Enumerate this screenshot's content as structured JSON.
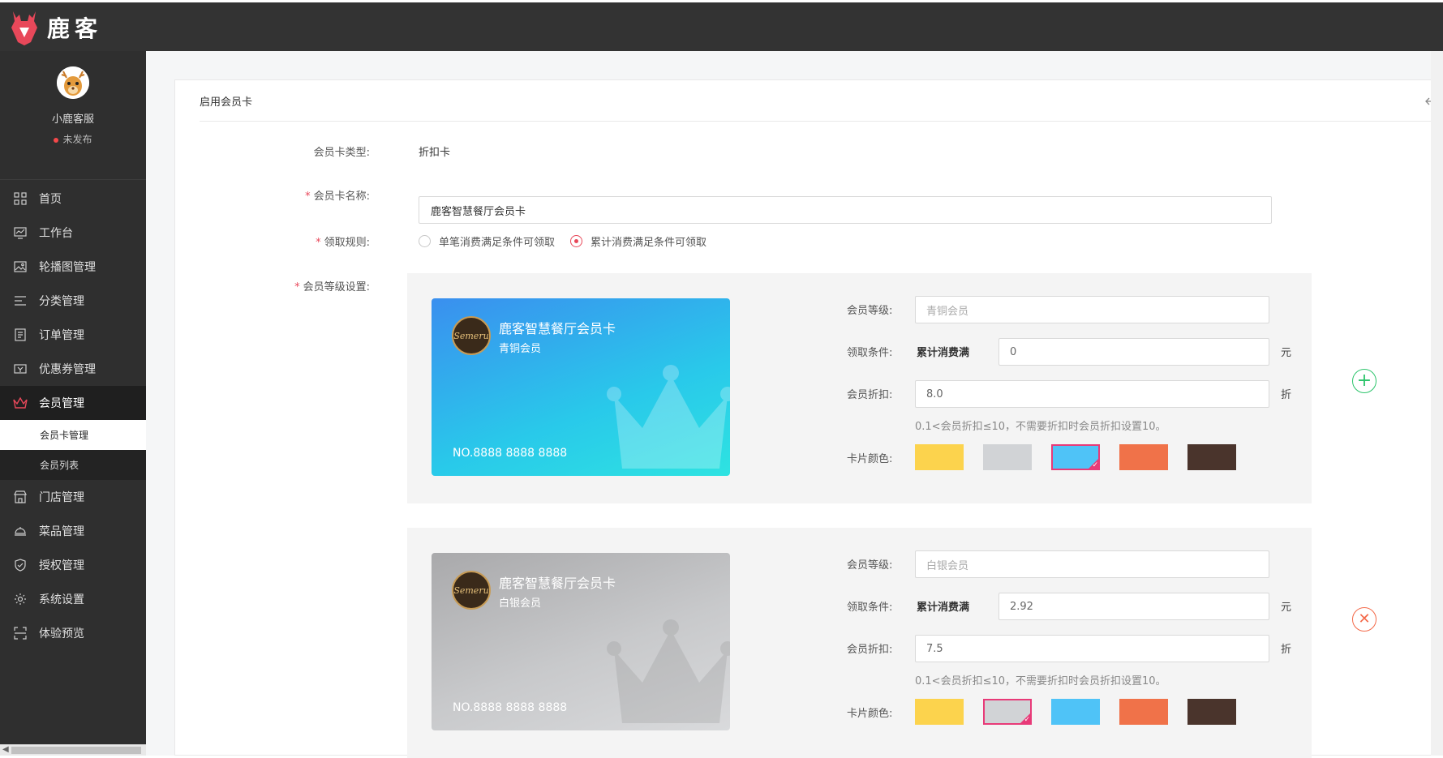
{
  "app": {
    "name": "鹿客"
  },
  "profile": {
    "name": "小鹿客服",
    "status": "未发布"
  },
  "sidebar": {
    "items": [
      {
        "label": "首页",
        "icon": "grid-icon"
      },
      {
        "label": "工作台",
        "icon": "monitor-icon"
      },
      {
        "label": "轮播图管理",
        "icon": "image-icon"
      },
      {
        "label": "分类管理",
        "icon": "list-icon"
      },
      {
        "label": "订单管理",
        "icon": "document-icon"
      },
      {
        "label": "优惠券管理",
        "icon": "coupon-icon"
      },
      {
        "label": "会员管理",
        "icon": "crown-icon"
      },
      {
        "label": "门店管理",
        "icon": "store-icon"
      },
      {
        "label": "菜品管理",
        "icon": "dish-icon"
      },
      {
        "label": "授权管理",
        "icon": "shield-icon"
      },
      {
        "label": "系统设置",
        "icon": "gear-icon"
      },
      {
        "label": "体验预览",
        "icon": "scan-icon"
      }
    ],
    "submenu": [
      {
        "label": "会员卡管理"
      },
      {
        "label": "会员列表"
      }
    ]
  },
  "panel": {
    "title": "启用会员卡"
  },
  "form": {
    "type_label": "会员卡类型:",
    "type_value": "折扣卡",
    "name_label": "会员卡名称:",
    "name_value": "鹿客智慧餐厅会员卡",
    "rule_label": "领取规则:",
    "rule_option_1": "单笔消费满足条件可领取",
    "rule_option_2": "累计消费满足条件可领取",
    "level_label": "会员等级设置:"
  },
  "levels": [
    {
      "card_title": "鹿客智慧餐厅会员卡",
      "card_level": "青铜会员",
      "card_no": "NO.8888 8888 8888",
      "logo_text": "Semeru",
      "level_label": "会员等级:",
      "level_placeholder": "青铜会员",
      "cond_label": "领取条件:",
      "cond_tag": "累计消费满",
      "cond_value": "0",
      "cond_unit": "元",
      "discount_label": "会员折扣:",
      "discount_value": "8.0",
      "discount_unit": "折",
      "hint": "0.1<会员折扣≤10，不需要折扣时会员折扣设置10。",
      "color_label": "卡片颜色:",
      "selected_color": "#4fc3f7",
      "action": "add"
    },
    {
      "card_title": "鹿客智慧餐厅会员卡",
      "card_level": "白银会员",
      "card_no": "NO.8888 8888 8888",
      "logo_text": "Semeru",
      "level_label": "会员等级:",
      "level_placeholder": "白银会员",
      "cond_label": "领取条件:",
      "cond_tag": "累计消费满",
      "cond_value": "2.92",
      "cond_unit": "元",
      "discount_label": "会员折扣:",
      "discount_value": "7.5",
      "discount_unit": "折",
      "hint": "0.1<会员折扣≤10，不需要折扣时会员折扣设置10。",
      "color_label": "卡片颜色:",
      "selected_color": "#d1d3d6",
      "action": "delete"
    }
  ],
  "swatch_colors": [
    "#fcd34d",
    "#d1d3d6",
    "#4fc3f7",
    "#f07249",
    "#4a342c"
  ]
}
